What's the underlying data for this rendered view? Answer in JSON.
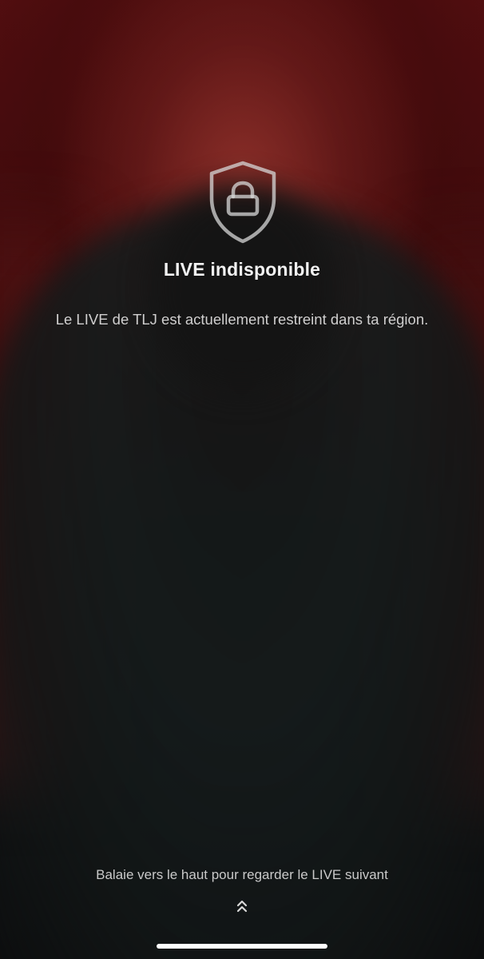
{
  "unavailable": {
    "icon": "shield-lock-icon",
    "title": "LIVE indisponible",
    "message": "Le LIVE de TLJ est actuellement restreint dans ta région."
  },
  "footer": {
    "swipe_hint": "Balaie vers le haut pour regarder le LIVE suivant",
    "swipe_icon": "chevrons-up-icon"
  },
  "colors": {
    "background_red": "#5a0f12",
    "background_dark": "#0c0d0e",
    "text_primary": "#f2f2f2",
    "text_secondary": "#d0cfcf"
  }
}
